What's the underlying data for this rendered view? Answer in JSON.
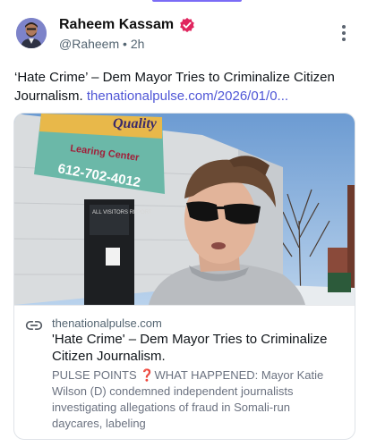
{
  "post": {
    "author_name": "Raheem Kassam",
    "handle": "@Raheem",
    "separator": "•",
    "time": "2h",
    "text": "‘Hate Crime’ – Dem Mayor Tries to Criminalize Citizen Journalism.",
    "link_text": "thenationalpulse.com/2026/01/0..."
  },
  "card": {
    "domain": "thenationalpulse.com",
    "title": "'Hate Crime' – Dem Mayor Tries to Criminalize Citizen Journalism.",
    "desc_prefix": "PULSE POINTS",
    "desc_icon": "❓",
    "desc_body": "WHAT HAPPENED: Mayor Katie Wilson (D) condemned independent journalists investigating allegations of fraud in Somali-run daycares, labeling",
    "sign_line1": "Quality",
    "sign_line2": "Learing Center",
    "sign_phone": "612-702-4012",
    "door_text": "ALL VISITORS REPORT",
    "icons": {
      "link": "link-icon",
      "more": "more-vertical-icon",
      "verified": "verified-badge-icon"
    }
  },
  "colors": {
    "accent": "#7b6cf6",
    "link": "#4f56d6",
    "verified": "#e0245e"
  }
}
